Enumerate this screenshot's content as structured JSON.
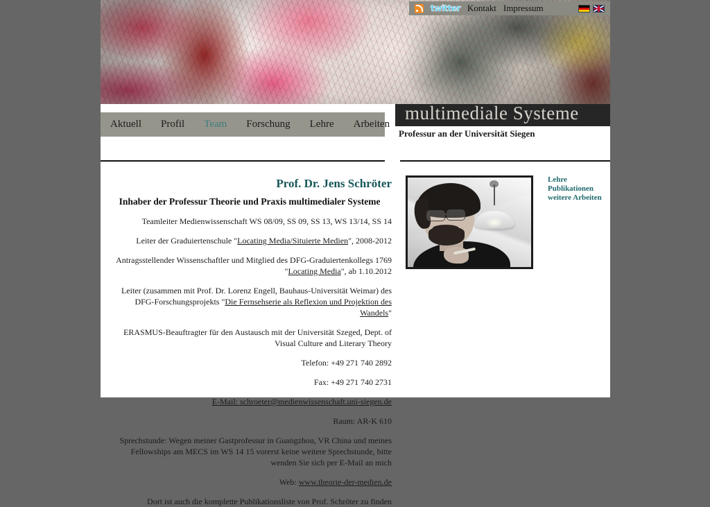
{
  "site": {
    "title": "multimediale Systeme",
    "subtitle": "Professur an der Universität Siegen"
  },
  "topbar": {
    "rss_icon": "rss-icon",
    "twitter_label": "twitter",
    "links": [
      {
        "label": "Kontakt"
      },
      {
        "label": "Impressum"
      }
    ],
    "flags": [
      {
        "name": "german-flag",
        "label": "Deutsch"
      },
      {
        "name": "uk-flag",
        "label": "English"
      }
    ]
  },
  "nav": {
    "items": [
      {
        "label": "Aktuell",
        "active": false
      },
      {
        "label": "Profil",
        "active": false
      },
      {
        "label": "Team",
        "active": true
      },
      {
        "label": "Forschung",
        "active": false
      },
      {
        "label": "Lehre",
        "active": false
      },
      {
        "label": "Arbeiten",
        "active": false
      }
    ]
  },
  "profile": {
    "name": "Prof. Dr. Jens Schröter",
    "role": "Inhaber der Professur Theorie und Praxis multimedialer Systeme",
    "paragraphs": [
      {
        "pre": "Teamleiter Medienwissenschaft WS 08/09, SS 09, SS 13, WS 13/14, SS 14",
        "link": "",
        "post": ""
      },
      {
        "pre": "Leiter der Graduiertenschule \"",
        "link": "Locating Media/Situierte Medien",
        "post": "\", 2008-2012"
      },
      {
        "pre": "Antragsstellender Wissenschaftler und Mitglied des DFG-Graduiertenkollegs 1769 \"",
        "link": "Locating Media",
        "post": "\", ab 1.10.2012"
      },
      {
        "pre": "Leiter (zusammen mit Prof. Dr. Lorenz Engell, Bauhaus-Universität Weimar) des DFG-Forschungsprojekts \"",
        "link": "Die Fernsehserie als Reflexion und Projektion des Wandels",
        "post": "\""
      },
      {
        "pre": "ERASMUS-Beauftragter für den Austausch mit der Universität Szeged, Dept. of Visual Culture and Literary Theory",
        "link": "",
        "post": ""
      },
      {
        "pre": "Telefon: +49 271 740 2892",
        "link": "",
        "post": ""
      },
      {
        "pre": "Fax: +49 271 740 2731",
        "link": "",
        "post": ""
      },
      {
        "pre": "E-Mail: ",
        "link": "schroeter@medienwissenschaft.uni-siegen.de",
        "post": ""
      },
      {
        "pre": "Raum: AR-K 610",
        "link": "",
        "post": ""
      },
      {
        "pre": "Sprechstunde: Wegen meiner Gastprofessur in Guangzhou, VR China und meines Fellowships am MECS im WS 14 15 vorerst keine weitere Sprechstunde, bitte wenden Sie sich per E-Mail an mich",
        "link": "",
        "post": ""
      },
      {
        "pre": "Web: ",
        "link": "www.theorie-der-medien.de",
        "post": ""
      },
      {
        "pre": "Dort ist auch die komplette Publikationsliste von Prof. Schröter zu finden",
        "link": "",
        "post": ""
      }
    ],
    "portrait_alt": "portrait-jens-schroeter"
  },
  "sidebar": {
    "items": [
      {
        "label": "Lehre"
      },
      {
        "label": "Publikationen"
      },
      {
        "label": "weitere Arbeiten"
      }
    ]
  },
  "colors": {
    "accent_teal": "#3d7d7d",
    "heading_teal": "#17565a",
    "sidebar_link": "#1f6a6e",
    "nav_bg": "#96958c",
    "topbar_bg": "#8a8a82",
    "title_bar_bg": "#262626",
    "page_bg": "#666666"
  }
}
